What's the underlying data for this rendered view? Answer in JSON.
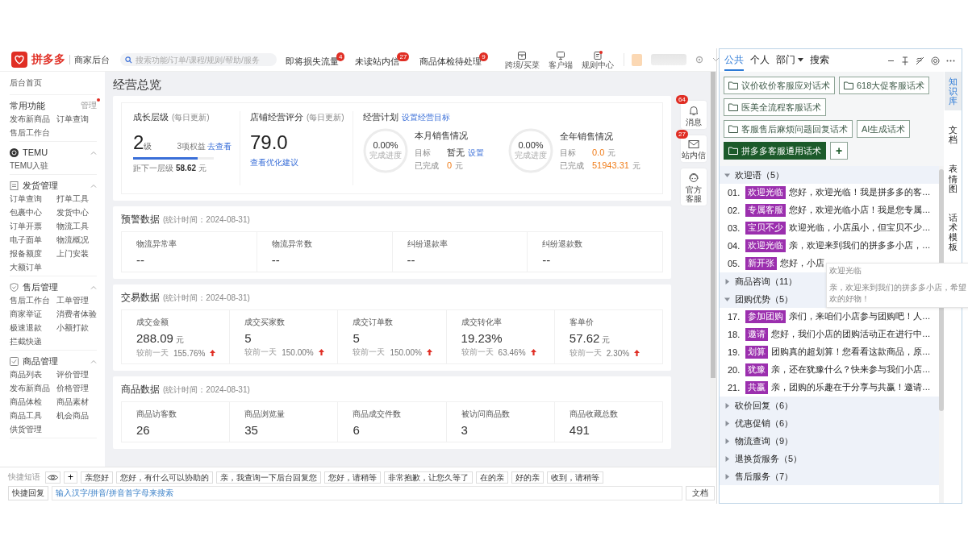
{
  "topbar": {
    "logo_text": "拼多多",
    "subtitle": "商家后台",
    "search": {
      "placeholder": "搜索功能/订单/课程/规则/帮助/服务"
    },
    "notices": [
      {
        "label": "即将损失流量",
        "badge": "4"
      },
      {
        "label": "未读站内信",
        "badge": "27"
      },
      {
        "label": "商品体检待处理",
        "badge": "9"
      }
    ],
    "tools": [
      {
        "label": "跨境/买菜",
        "kind": "store",
        "dot": false
      },
      {
        "label": "客户端",
        "kind": "desktop",
        "dot": false
      },
      {
        "label": "规则中心",
        "kind": "doc",
        "dot": true
      }
    ]
  },
  "sidebar": {
    "home": "后台首页",
    "sections": [
      {
        "kind": "favorites",
        "title": "常用功能",
        "action": "管理",
        "action_dot": true,
        "items": [
          "发布新商品",
          "订单查询",
          "售后工作台"
        ]
      },
      {
        "kind": "group",
        "title": "TEMU",
        "expanded": true,
        "items": [
          "TEMU入驻"
        ]
      },
      {
        "kind": "group",
        "title": "发货管理",
        "expanded": true,
        "items": [
          "订单查询",
          "打单工具",
          "包裹中心",
          "发货中心",
          "订单开票",
          "物流工具",
          "电子面单",
          "物流概况",
          "报备额度",
          "上门安装",
          "大额订单"
        ]
      },
      {
        "kind": "group",
        "title": "售后管理",
        "expanded": true,
        "items": [
          "售后工作台",
          "工单管理",
          "商家举证",
          "消费者体验",
          "极速退款",
          "小额打款",
          "拦截快递"
        ]
      },
      {
        "kind": "group",
        "title": "商品管理",
        "expanded": true,
        "items": [
          "商品列表",
          "评价管理",
          "发布新商品",
          "价格管理",
          "商品体检",
          "商品素材",
          "商品工具",
          "机会商品",
          "供货管理"
        ]
      }
    ]
  },
  "page_title": "经营总览",
  "overview": {
    "growth": {
      "title": "成长层级",
      "note": "(每日更新)",
      "value": "2",
      "unit": "级",
      "benefits": "3项权益",
      "benefits_link": "去查看",
      "level": 0.8,
      "next_label": "距下一层级",
      "next_value": "58.62",
      "next_unit": "元"
    },
    "score": {
      "title": "店铺经营评分",
      "note": "(每日更新)",
      "value": "79.0",
      "link": "查看优化建议"
    },
    "plan": {
      "title": "经营计划",
      "link": "设置经营目标",
      "blocks": [
        {
          "percent": "0.00%",
          "percent_label": "完成进度",
          "title": "本月销售情况",
          "target_label": "目标",
          "target": "暂无",
          "target_highlight": false,
          "target_link": "设置",
          "done_label": "已完成",
          "done": "0",
          "done_unit": "元"
        },
        {
          "percent": "0.00%",
          "percent_label": "完成进度",
          "title": "全年销售情况",
          "target_label": "目标",
          "target": "0.0",
          "target_highlight": true,
          "target_unit": "元",
          "done_label": "已完成",
          "done": "51943.31",
          "done_unit": "元"
        }
      ]
    }
  },
  "sections": [
    {
      "title": "预警数据",
      "note": "(统计时间：2024-08-31)",
      "metrics": [
        {
          "label": "物流异常率",
          "value": "--"
        },
        {
          "label": "物流异常数",
          "value": "--"
        },
        {
          "label": "纠纷退款率",
          "value": "--"
        },
        {
          "label": "纠纷退款数",
          "value": "--"
        }
      ]
    },
    {
      "title": "交易数据",
      "note": "(统计时间：2024-08-31)",
      "metrics": [
        {
          "label": "成交金额",
          "value": "288.09",
          "unit": "元",
          "compare_label": "较前一天",
          "change": "155.76%"
        },
        {
          "label": "成交买家数",
          "value": "5",
          "compare_label": "较前一天",
          "change": "150.00%"
        },
        {
          "label": "成交订单数",
          "value": "5",
          "compare_label": "较前一天",
          "change": "150.00%"
        },
        {
          "label": "成交转化率",
          "value": "19.23%",
          "compare_label": "较前一天",
          "change": "63.46%"
        },
        {
          "label": "客单价",
          "value": "57.62",
          "unit": "元",
          "compare_label": "较前一天",
          "change": "2.30%"
        }
      ]
    },
    {
      "title": "商品数据",
      "note": "(统计时间：2024-08-31)",
      "metrics": [
        {
          "label": "商品访客数",
          "value": "26"
        },
        {
          "label": "商品浏览量",
          "value": "35"
        },
        {
          "label": "商品成交件数",
          "value": "6"
        },
        {
          "label": "被访问商品数",
          "value": "3"
        },
        {
          "label": "商品收藏总数",
          "value": "491"
        }
      ]
    }
  ],
  "float_buttons": [
    {
      "label": "消息",
      "badge": "64"
    },
    {
      "label": "站内信",
      "badge": "27"
    },
    {
      "label": "官方客服"
    }
  ],
  "quickbar": {
    "phrases_label": "快捷短语",
    "add": "+",
    "phrases": [
      "亲您好",
      "您好，有什么可以协助的",
      "亲，我查询一下后台回复您",
      "您好，请稍等",
      "非常抱歉，让您久等了",
      "在的亲",
      "好的亲",
      "收到，请稍等"
    ],
    "reply_button": "快捷回复",
    "search": {
      "placeholder": "输入汉字/拼音/拼音首字母来搜索"
    },
    "doc_button": "文档"
  },
  "kb": {
    "tabs": [
      {
        "label": "公共",
        "selected": true,
        "dropdown": false
      },
      {
        "label": "个人",
        "selected": false,
        "dropdown": false
      },
      {
        "label": "部门",
        "selected": false,
        "dropdown": true
      },
      {
        "label": "搜索",
        "selected": false,
        "dropdown": false
      }
    ],
    "folders": [
      {
        "label": "议价砍价客服应对话术",
        "kind": "folder",
        "selected": false
      },
      {
        "label": "618大促客服话术",
        "kind": "folder",
        "selected": false
      },
      {
        "label": "医美全流程客服话术",
        "kind": "folder",
        "selected": false
      },
      {
        "label": "客服售后麻烦问题回复话术",
        "kind": "folder",
        "selected": false
      },
      {
        "label": "AI生成话术",
        "kind": "plain",
        "selected": false
      },
      {
        "label": "拼多多客服通用话术",
        "kind": "folder",
        "selected": true
      }
    ],
    "add_button": "+",
    "side_tabs": [
      {
        "label": "知识库",
        "selected": true
      },
      {
        "label": "文档",
        "selected": false
      },
      {
        "label": "表情图",
        "selected": false
      },
      {
        "label": "话术模板",
        "selected": false
      }
    ],
    "groups": [
      {
        "title": "欢迎语（5）",
        "expanded": true,
        "items": [
          {
            "number": "01.",
            "tag": "欢迎光临",
            "text": "您好，欢迎光临！我是拼多多的客…"
          },
          {
            "number": "02.",
            "tag": "专属客服",
            "text": "您好，欢迎光临小店！我是您专属…"
          },
          {
            "number": "03.",
            "tag": "宝贝不少",
            "text": "欢迎光临，小店虽小，但宝贝不少…"
          },
          {
            "number": "04.",
            "tag": "欢迎光临",
            "text": "亲，欢迎来到我们的拼多多小店，…"
          },
          {
            "number": "05.",
            "tag": "新开张",
            "text": "您好，小店"
          }
        ]
      },
      {
        "title": "商品咨询（11）",
        "expanded": false
      },
      {
        "title": "团购优势（5）",
        "expanded": true,
        "items": [
          {
            "number": "17.",
            "tag": "参加团购",
            "text": "亲们，来咱们小店参与团购吧！人…"
          },
          {
            "number": "18.",
            "tag": "邀请",
            "text": "您好，我们小店的团购活动正在进行中…"
          },
          {
            "number": "19.",
            "tag": "划算",
            "text": "团购真的超划算！您看看这款商品，原…"
          },
          {
            "number": "20.",
            "tag": "犹豫",
            "text": "亲，还在犹豫什么？快来参与我们小店…"
          },
          {
            "number": "21.",
            "tag": "共赢",
            "text": "亲，团购的乐趣在于分享与共赢！邀请…"
          }
        ]
      },
      {
        "title": "砍价回复（6）",
        "expanded": false
      },
      {
        "title": "优惠促销（6）",
        "expanded": false
      },
      {
        "title": "物流查询（9）",
        "expanded": false
      },
      {
        "title": "退换货服务（5）",
        "expanded": false
      },
      {
        "title": "售后服务（7）",
        "expanded": false
      }
    ],
    "tooltip": {
      "title": "欢迎光临",
      "lines": [
        "亲，欢迎来到我们的拼多多小店，希望",
        "欢的好物！"
      ]
    }
  }
}
